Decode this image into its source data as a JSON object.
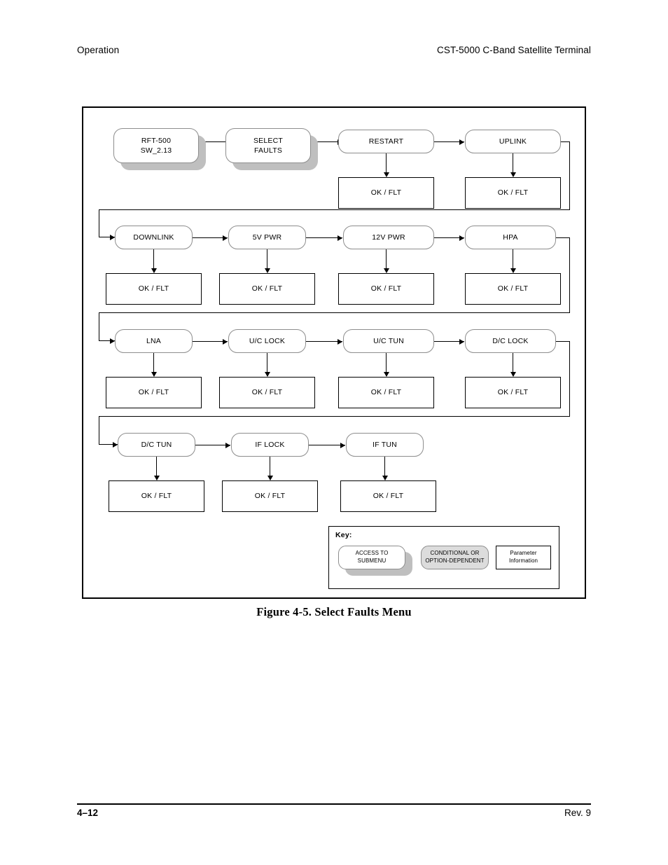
{
  "header": {
    "left": "Operation",
    "right": "CST-5000 C-Band Satellite Terminal"
  },
  "caption": "Figure 4-5.  Select Faults Menu",
  "footer": {
    "page_number": "4–12",
    "revision": "Rev. 9"
  },
  "status_label": "OK / FLT",
  "flow": {
    "entry": [
      {
        "label": "RFT-500\nSW_2.13",
        "style": "shadowed"
      },
      {
        "label": "SELECT\nFAULTS",
        "style": "shadowed"
      }
    ],
    "rows": [
      {
        "nodes": [
          {
            "label": "RESTART",
            "status": "OK / FLT"
          },
          {
            "label": "UPLINK",
            "status": "OK / FLT"
          }
        ]
      },
      {
        "nodes": [
          {
            "label": "DOWNLINK",
            "status": "OK / FLT"
          },
          {
            "label": "5V PWR",
            "status": "OK / FLT"
          },
          {
            "label": "12V PWR",
            "status": "OK / FLT"
          },
          {
            "label": "HPA",
            "status": "OK / FLT"
          }
        ]
      },
      {
        "nodes": [
          {
            "label": "LNA",
            "status": "OK / FLT"
          },
          {
            "label": "U/C LOCK",
            "status": "OK / FLT"
          },
          {
            "label": "U/C TUN",
            "status": "OK / FLT"
          },
          {
            "label": "D/C LOCK",
            "status": "OK / FLT"
          }
        ]
      },
      {
        "nodes": [
          {
            "label": "D/C TUN",
            "status": "OK / FLT"
          },
          {
            "label": "IF LOCK",
            "status": "OK / FLT"
          },
          {
            "label": "IF TUN",
            "status": "OK / FLT"
          }
        ]
      }
    ]
  },
  "key": {
    "title": "Key:",
    "items": [
      {
        "label": "ACCESS TO\nSUBMENU",
        "style": "shadowed-rounded"
      },
      {
        "label": "CONDITIONAL OR\nOPTION-DEPENDENT",
        "style": "gray-rounded"
      },
      {
        "label": "Parameter Information",
        "style": "rectangle"
      }
    ]
  },
  "colors": {
    "shadow": "#bfbfbf",
    "conditional_fill": "#dcdcdc",
    "node_border": "#8d8d8d",
    "rect_border": "#000000"
  }
}
